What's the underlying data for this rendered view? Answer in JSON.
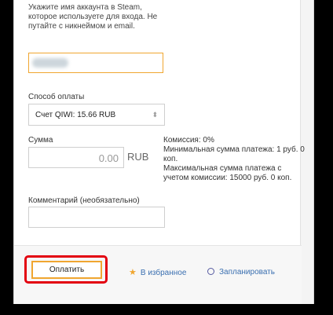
{
  "form": {
    "account_hint": "Укажите имя аккаунта в Steam, которое используете для входа. Не путайте с никнеймом и email.",
    "payment_method_label": "Способ оплаты",
    "payment_method_value": "Счет QIWI: 15.66 RUB",
    "amount_label": "Сумма",
    "amount_value": "0.00",
    "currency": "RUB",
    "commission_info": "Комиссия: 0%\nМинимальная сумма платежа: 1 руб. 0 коп.\nМаксимальная сумма платежа с учетом комиссии: 15000 руб. 0 коп.",
    "comment_label": "Комментарий (необязательно)"
  },
  "actions": {
    "pay": "Оплатить",
    "favorite": "В избранное",
    "schedule": "Запланировать"
  },
  "colors": {
    "accent": "#f0a630",
    "highlight": "#e3000f",
    "link": "#3a6fb0"
  }
}
